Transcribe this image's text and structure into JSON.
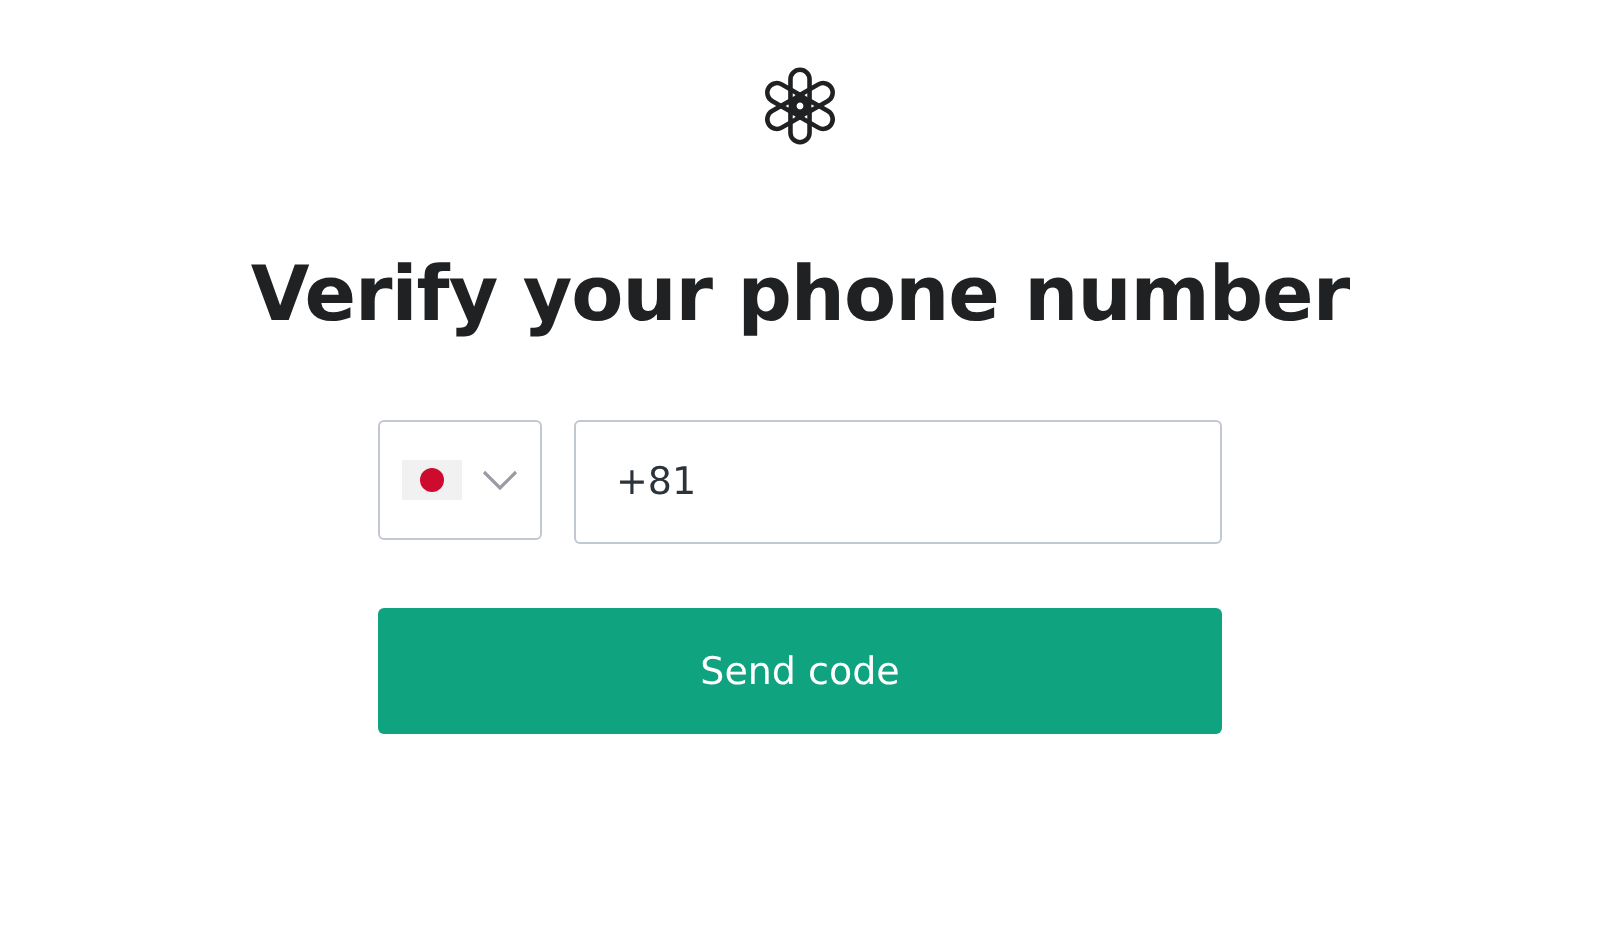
{
  "heading": "Verify your phone number",
  "phone": {
    "value": "+81"
  },
  "submit": {
    "label": "Send code"
  }
}
